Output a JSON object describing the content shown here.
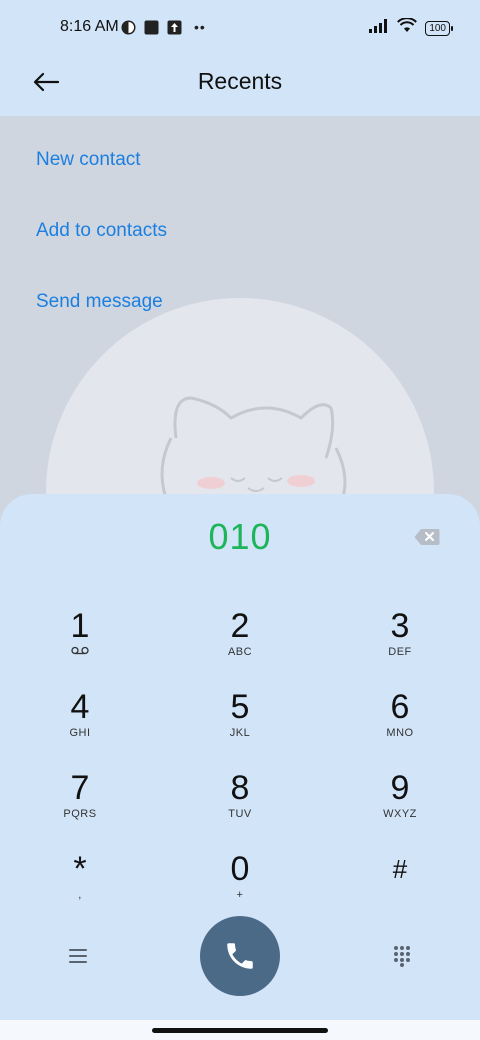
{
  "status_bar": {
    "time": "8:16 AM",
    "battery": "100"
  },
  "header": {
    "title": "Recents"
  },
  "menu": {
    "items": [
      "New contact",
      "Add to contacts",
      "Send message"
    ]
  },
  "dialer": {
    "number": "010",
    "keys": [
      {
        "digit": "1",
        "letters": ""
      },
      {
        "digit": "2",
        "letters": "ABC"
      },
      {
        "digit": "3",
        "letters": "DEF"
      },
      {
        "digit": "4",
        "letters": "GHI"
      },
      {
        "digit": "5",
        "letters": "JKL"
      },
      {
        "digit": "6",
        "letters": "MNO"
      },
      {
        "digit": "7",
        "letters": "PQRS"
      },
      {
        "digit": "8",
        "letters": "TUV"
      },
      {
        "digit": "9",
        "letters": "WXYZ"
      },
      {
        "digit": "*",
        "letters": ","
      },
      {
        "digit": "0",
        "letters": "+"
      },
      {
        "digit": "#",
        "letters": ""
      }
    ]
  },
  "colors": {
    "accent_link": "#1c7fe0",
    "number": "#1db45a",
    "call_button": "#4b6a88",
    "panel": "#d2e4f8"
  }
}
